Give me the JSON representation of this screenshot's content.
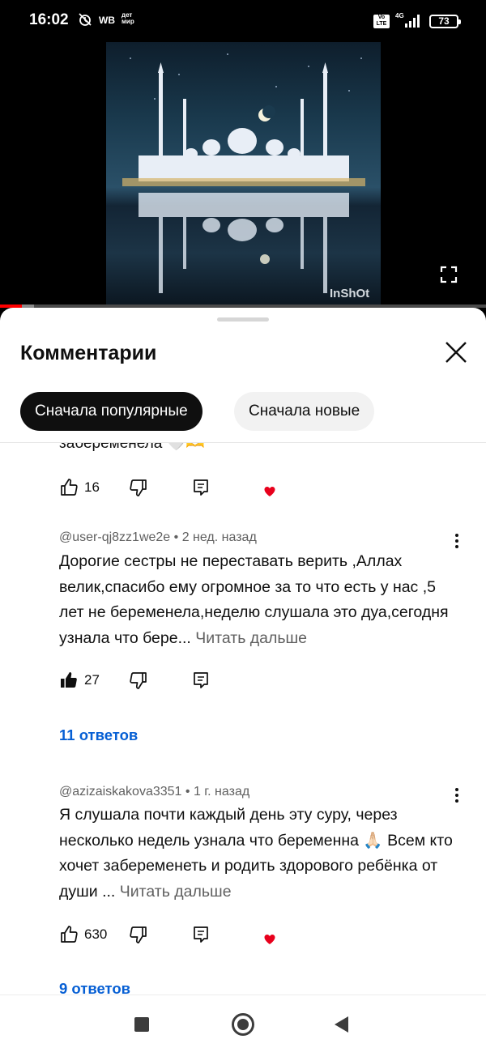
{
  "status_bar": {
    "time": "16:02",
    "carrier_badge": "WB",
    "store_badge_line1": "дет",
    "store_badge_line2": "мир",
    "volte_line1": "Vo",
    "volte_line2": "LTE",
    "network": "4G",
    "battery": "73",
    "icons": [
      "alarm-off-icon",
      "signal-icon",
      "battery-icon"
    ]
  },
  "video": {
    "watermark": "InShOt",
    "progress_fraction": 0.045,
    "buffer_fraction": 0.07,
    "icons": [
      "fullscreen-icon"
    ]
  },
  "comments_panel": {
    "title": "Комментарии",
    "sort_chips": [
      {
        "label": "Сначала популярные",
        "selected": true
      },
      {
        "label": "Сначала новые",
        "selected": false
      }
    ],
    "partial_comment": {
      "text_fragment": "забеременела 🤍🫶",
      "likes": "16",
      "creator_hearted": true
    },
    "comments": [
      {
        "author": "@user-qj8zz1we2e",
        "time": "2 нед. назад",
        "text": "Дорогие сестры не переставать верить ,Аллах велик,спасибо ему огромное за то что есть у нас ,5 лет не беременела,неделю слушала это дуа,сегодня узнала что бере...",
        "read_more": "Читать дальше",
        "likes": "27",
        "liked_by_user": true,
        "creator_hearted": false,
        "replies_label": "11 ответов"
      },
      {
        "author": "@azizaiskakova3351",
        "time": "1 г. назад",
        "text": "Я слушала почти каждый день эту суру, через несколько недель узнала что беременна 🙏🏻 Всем кто хочет забеременеть и родить здорового ребёнка от души ...",
        "read_more": "Читать дальше",
        "likes": "630",
        "liked_by_user": false,
        "creator_hearted": true,
        "replies_label": "9 ответов"
      }
    ]
  },
  "colors": {
    "accent_blue": "#065fd4",
    "heart_red": "#e8001c",
    "progress_red": "#ff0000",
    "text_primary": "#0f0f0f",
    "text_secondary": "#606060"
  }
}
